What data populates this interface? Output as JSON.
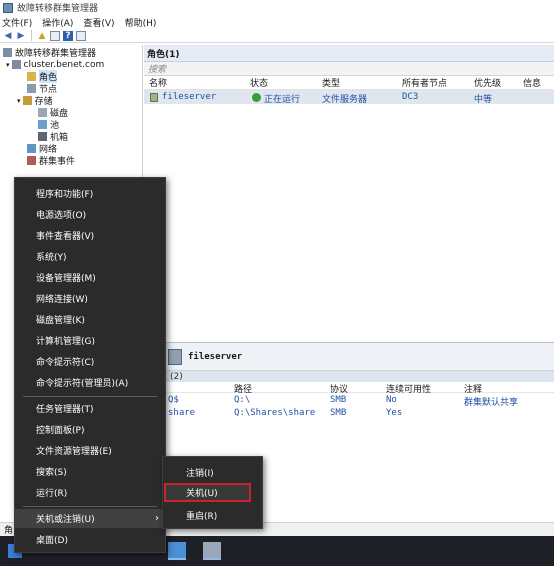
{
  "window": {
    "title": "故障转移群集管理器"
  },
  "menu": {
    "file": "文件(F)",
    "action": "操作(A)",
    "view": "查看(V)",
    "help": "帮助(H)"
  },
  "tree": {
    "root": "故障转移群集管理器",
    "cluster": "cluster.benet.com",
    "roles": "角色",
    "nodes": "节点",
    "storage": "存储",
    "disks": "磁盘",
    "pools": "池",
    "enclosures": "机箱",
    "networks": "网络",
    "cluster_events": "群集事件"
  },
  "roles_pane": {
    "header": "角色(1)",
    "search_placeholder": "搜索",
    "columns": [
      "名称",
      "状态",
      "类型",
      "所有者节点",
      "优先级",
      "信息"
    ],
    "rows": [
      {
        "name": "fileserver",
        "status": "正在运行",
        "type": "文件服务器",
        "owner": "DC3",
        "priority": "中等",
        "info": ""
      }
    ]
  },
  "detail_pane": {
    "title": "fileserver",
    "shares_label": "(2)",
    "columns": [
      "路径",
      "协议",
      "连续可用性",
      "注释"
    ],
    "rows": [
      {
        "name": "Q$",
        "path": "Q:\\",
        "protocol": "SMB",
        "ca": "No",
        "comment": "群集默认共享"
      },
      {
        "name": "share",
        "path": "Q:\\Shares\\share",
        "protocol": "SMB",
        "ca": "Yes",
        "comment": ""
      }
    ]
  },
  "statusbar": {
    "text": "角"
  },
  "context_menu": {
    "items": [
      {
        "label": "程序和功能(F)"
      },
      {
        "label": "电源选项(O)"
      },
      {
        "label": "事件查看器(V)"
      },
      {
        "label": "系统(Y)"
      },
      {
        "label": "设备管理器(M)"
      },
      {
        "label": "网络连接(W)"
      },
      {
        "label": "磁盘管理(K)"
      },
      {
        "label": "计算机管理(G)"
      },
      {
        "label": "命令提示符(C)"
      },
      {
        "label": "命令提示符(管理员)(A)"
      },
      {
        "label": "任务管理器(T)"
      },
      {
        "label": "控制面板(P)"
      },
      {
        "label": "文件资源管理器(E)"
      },
      {
        "label": "搜索(S)"
      },
      {
        "label": "运行(R)"
      },
      {
        "label": "关机或注销(U)"
      },
      {
        "label": "桌面(D)"
      }
    ],
    "submenu": [
      {
        "label": "注销(I)"
      },
      {
        "label": "关机(U)"
      },
      {
        "label": "重启(R)"
      }
    ],
    "highlight_color": "#c9242b"
  }
}
